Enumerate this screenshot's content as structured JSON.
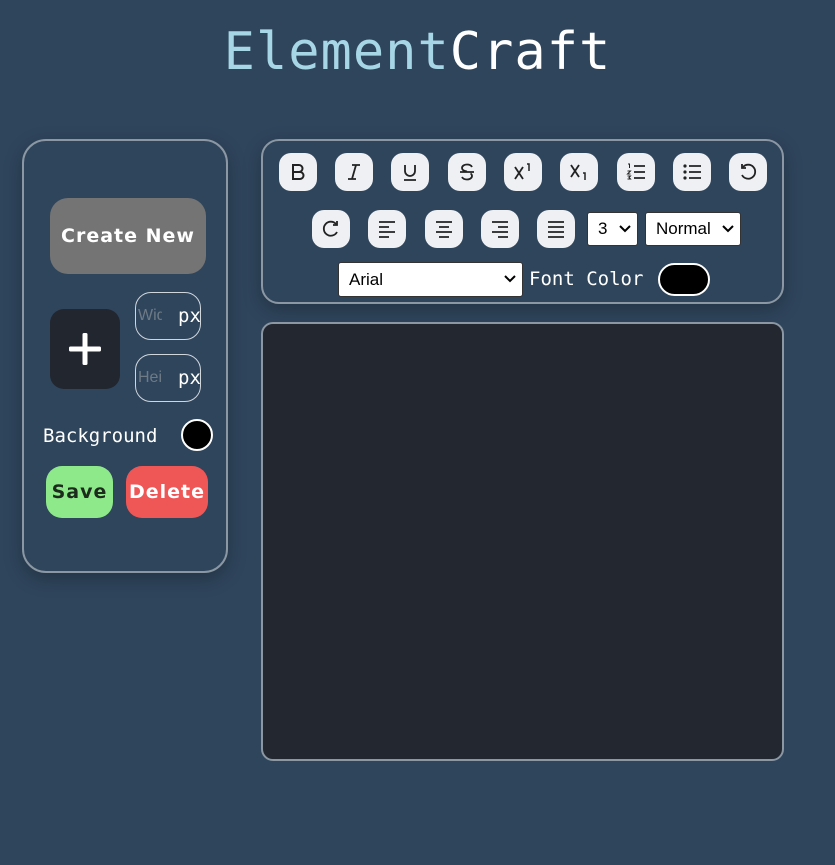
{
  "app": {
    "title_part1": "Element",
    "title_part2": "Craft"
  },
  "sidebar": {
    "create_label": "Create New",
    "width_placeholder": "Width",
    "height_placeholder": "Height",
    "unit": "px",
    "background_label": "Background",
    "background_color": "#000000",
    "save_label": "Save",
    "delete_label": "Delete"
  },
  "toolbar": {
    "buttons_row1": [
      "bold-icon",
      "italic-icon",
      "underline-icon",
      "strikethrough-icon",
      "superscript-icon",
      "subscript-icon",
      "ordered-list-icon",
      "unordered-list-icon",
      "undo-icon"
    ],
    "buttons_row2": [
      "redo-icon",
      "align-left-icon",
      "align-center-icon",
      "align-right-icon",
      "justify-icon"
    ],
    "font_size": "3",
    "format": "Normal",
    "font_family": "Arial",
    "font_color_label": "Font Color",
    "font_color": "#000000"
  },
  "colors": {
    "background": "#2f455c",
    "editor": "#222730",
    "accent": "#a7d6e6",
    "save": "#8ee98b",
    "delete": "#ef5757"
  }
}
